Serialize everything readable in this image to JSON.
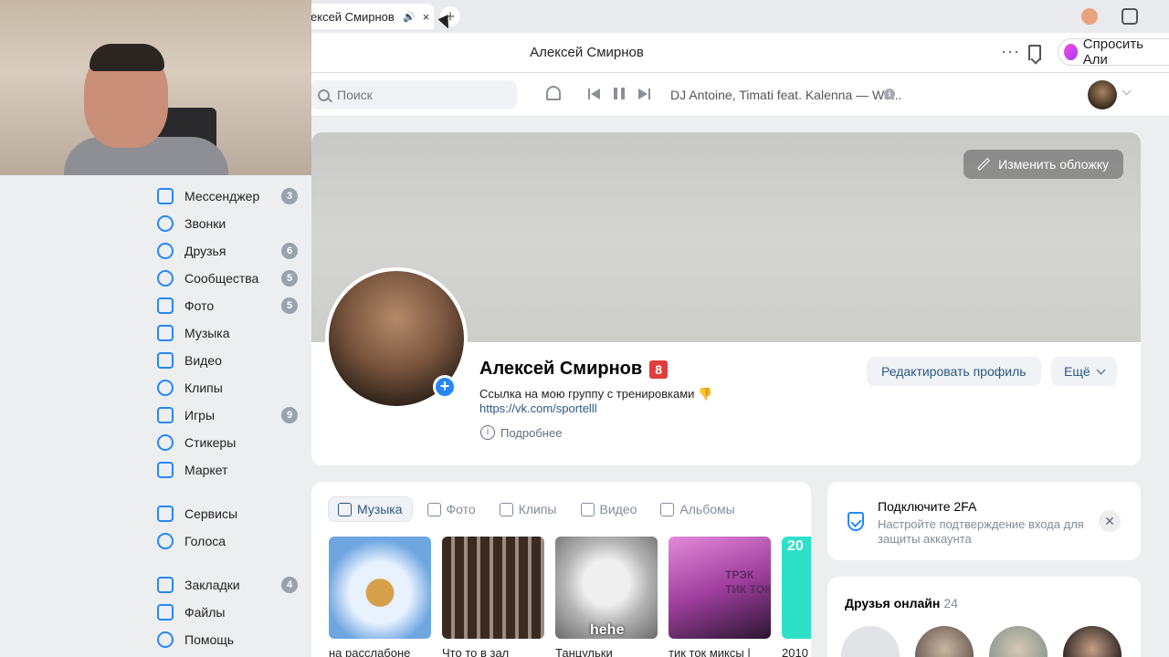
{
  "browser": {
    "tab_title": "ексей Смирнов",
    "tab_close": "×",
    "new_tab": "+",
    "window_title": "Алексей Смирнов",
    "menu_dots": "···",
    "ask_alice": "Спросить Али"
  },
  "header": {
    "search_placeholder": "Поиск",
    "now_playing": "DJ Antoine, Timati feat. Kalenna — We...",
    "info": "i"
  },
  "sidebar": {
    "items": [
      {
        "label": "Мессенджер",
        "badge": "3",
        "icon": "message-icon"
      },
      {
        "label": "Звонки",
        "badge": "",
        "icon": "phone-icon"
      },
      {
        "label": "Друзья",
        "badge": "6",
        "icon": "friends-icon"
      },
      {
        "label": "Сообщества",
        "badge": "5",
        "icon": "communities-icon"
      },
      {
        "label": "Фото",
        "badge": "5",
        "icon": "photo-icon"
      },
      {
        "label": "Музыка",
        "badge": "",
        "icon": "music-icon"
      },
      {
        "label": "Видео",
        "badge": "",
        "icon": "video-icon"
      },
      {
        "label": "Клипы",
        "badge": "",
        "icon": "clips-icon"
      },
      {
        "label": "Игры",
        "badge": "9",
        "icon": "games-icon"
      },
      {
        "label": "Стикеры",
        "badge": "",
        "icon": "stickers-icon"
      },
      {
        "label": "Маркет",
        "badge": "",
        "icon": "market-icon"
      },
      {
        "label": "Сервисы",
        "badge": "",
        "icon": "services-icon"
      },
      {
        "label": "Голоса",
        "badge": "",
        "icon": "votes-icon"
      },
      {
        "label": "Закладки",
        "badge": "4",
        "icon": "bookmarks-icon"
      },
      {
        "label": "Файлы",
        "badge": "",
        "icon": "files-icon"
      },
      {
        "label": "Помощь",
        "badge": "",
        "icon": "help-icon"
      }
    ]
  },
  "profile": {
    "change_cover": "Изменить обложку",
    "name": "Алексей Смирнов",
    "name_emoji": "8",
    "status": "Ссылка на мою группу с тренировками 👎",
    "link": "https://vk.com/sportelll",
    "more_info": "Подробнее",
    "edit_button": "Редактировать профиль",
    "more_button": "Ещё",
    "add_photo": "+"
  },
  "media": {
    "tabs": [
      {
        "label": "Музыка",
        "active": true
      },
      {
        "label": "Фото",
        "active": false
      },
      {
        "label": "Клипы",
        "active": false
      },
      {
        "label": "Видео",
        "active": false
      },
      {
        "label": "Альбомы",
        "active": false
      }
    ],
    "items": [
      {
        "caption": "на расслабоне"
      },
      {
        "caption": "Что то в зал"
      },
      {
        "caption": "Танцульки",
        "overlay": "hehe"
      },
      {
        "caption": "тик ток миксы |",
        "overlay": "ТРЭК\nТИК ТОК"
      },
      {
        "caption": "2010 |",
        "overlay": "20"
      }
    ]
  },
  "twofa": {
    "title": "Подключите 2FA",
    "text": "Настройте подтверждение входа для защиты аккаунта",
    "close": "✕"
  },
  "friends": {
    "title": "Друзья онлайн",
    "count": "24"
  },
  "colors": {
    "accent": "#2787f5",
    "link": "#2a5885",
    "badge": "#99a2ad",
    "page_bg": "#edeef0"
  }
}
